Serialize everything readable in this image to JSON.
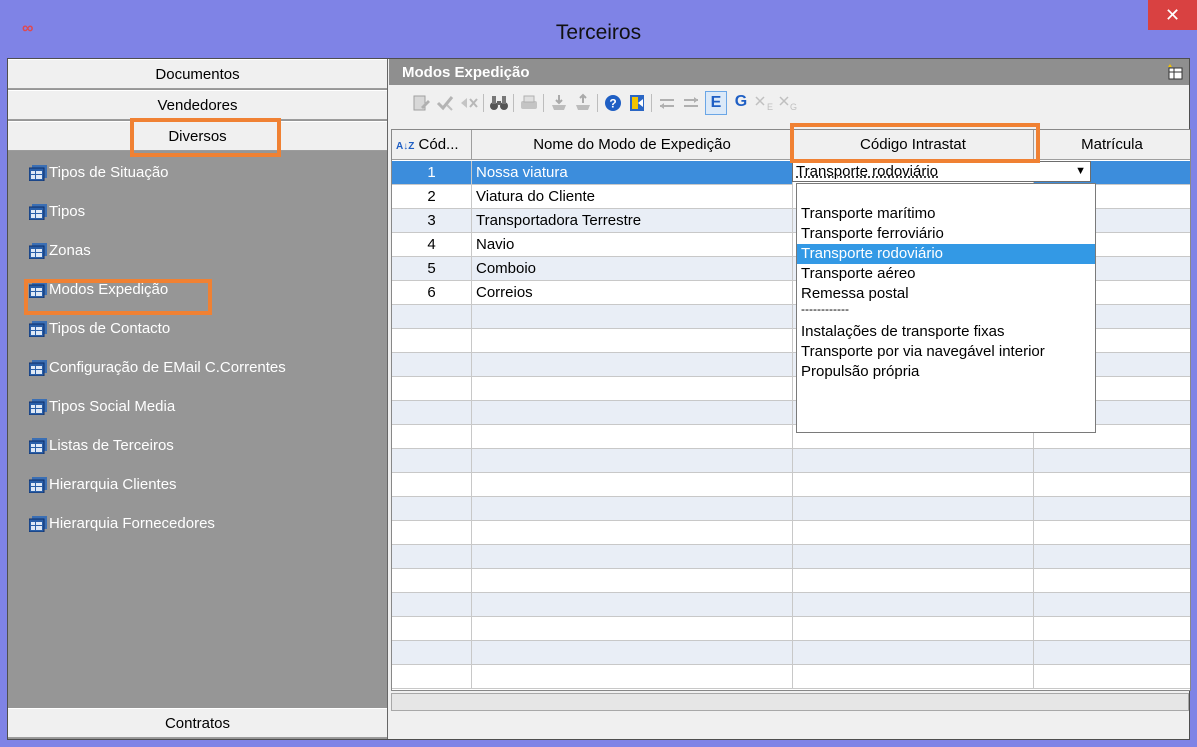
{
  "window": {
    "title": "Terceiros",
    "logo_glyph": "∞",
    "close_glyph": "✕"
  },
  "leftpanel": {
    "top_buttons": [
      "Documentos",
      "Vendedores",
      "Diversos"
    ],
    "items": [
      {
        "label": "Tipos de Situação",
        "icon": "table-icon"
      },
      {
        "label": "Tipos",
        "icon": "table-icon"
      },
      {
        "label": "Zonas",
        "icon": "table-icon"
      },
      {
        "label": "Modos Expedição",
        "icon": "table-icon"
      },
      {
        "label": "Tipos de Contacto",
        "icon": "table-icon"
      },
      {
        "label": "Configuração de EMail C.Correntes",
        "icon": "table-icon"
      },
      {
        "label": "Tipos Social Media",
        "icon": "table-icon"
      },
      {
        "label": "Listas de Terceiros",
        "icon": "table-icon"
      },
      {
        "label": "Hierarquia Clientes",
        "icon": "table-icon"
      },
      {
        "label": "Hierarquia Fornecedores",
        "icon": "table-icon"
      }
    ],
    "bottom_button": "Contratos"
  },
  "main": {
    "header": "Modos Expedição",
    "toolbar": {
      "text_buttons": [
        "E",
        "G"
      ]
    },
    "columns": [
      "Cód...",
      "Nome do Modo de Expedição",
      "Código Intrastat",
      "Matrícula"
    ],
    "sort_glyph": "A↓Z",
    "rows": [
      {
        "code": "1",
        "name": "Nossa viatura"
      },
      {
        "code": "2",
        "name": "Viatura do Cliente"
      },
      {
        "code": "3",
        "name": "Transportadora Terrestre"
      },
      {
        "code": "4",
        "name": "Navio"
      },
      {
        "code": "5",
        "name": "Comboio"
      },
      {
        "code": "6",
        "name": "Correios"
      }
    ],
    "intrastat_dropdown": {
      "value": "Transporte rodoviário",
      "arrow_glyph": "▼",
      "options": [
        "",
        "Transporte marítimo",
        "Transporte ferroviário",
        "Transporte rodoviário",
        "Transporte aéreo",
        "Remessa postal",
        "------------",
        "Instalações de transporte fixas",
        "Transporte por via navegável interior",
        "Propulsão própria"
      ],
      "selected_index": 3
    }
  },
  "colors": {
    "titlebar": "#7f83e6",
    "highlight": "#f08133",
    "selection": "#3c8ddc",
    "close": "#d94141"
  }
}
